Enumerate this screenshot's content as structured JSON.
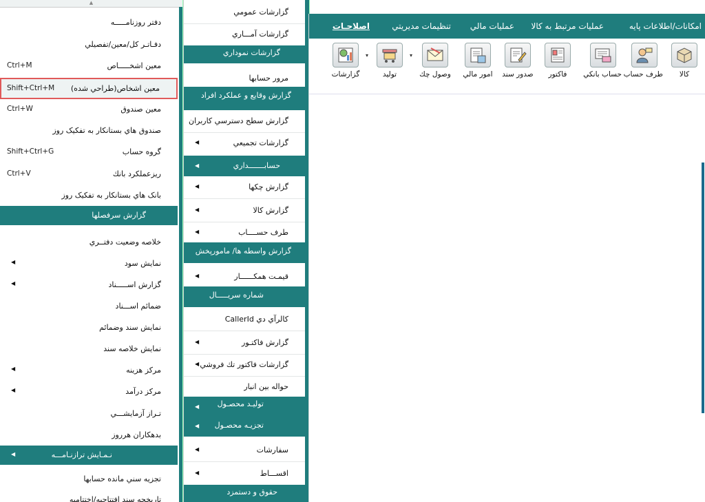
{
  "menubar": {
    "items": [
      "امکانات/اطلاعات پايه",
      "عمليات مرتبط به کالا",
      "عمليات مالي",
      "تنظيمات مديريتي",
      "اصلاحـات"
    ]
  },
  "toolbar": {
    "buttons": [
      "کالا",
      "طرف حساب",
      "حساب بانکي",
      "فاکتور",
      "صدور سند",
      "امور مالي",
      "وصول چك",
      "توليد",
      "گزارشات"
    ]
  },
  "left_menu": {
    "items": [
      {
        "label": "دفتر روزنامـــــه",
        "shortcut": ""
      },
      {
        "label": "دفـاتـر کل/معين/تفصيلي",
        "shortcut": ""
      },
      {
        "label": "معين اشخـــــاص",
        "shortcut": "Ctrl+M"
      },
      {
        "label": "معين اشخاص(طراحي شده)",
        "shortcut": "Shift+Ctrl+M"
      },
      {
        "label": "معين صندوق",
        "shortcut": "Ctrl+W"
      },
      {
        "label": "صندوق هاي بستانکار به تفکيک روز",
        "shortcut": ""
      },
      {
        "label": "گروه حساب",
        "shortcut": "Shift+Ctrl+G"
      },
      {
        "label": "ريزعملکرد بانك",
        "shortcut": "Ctrl+V"
      },
      {
        "label": "بانک هاي بستانکار به تفکيک روز",
        "shortcut": ""
      }
    ],
    "header1": "گزارش سرفصلها",
    "items2": [
      {
        "label": "خلاصه وضعيت دفتــري",
        "submenu": false
      },
      {
        "label": "نمايش سود",
        "submenu": true
      },
      {
        "label": "گزارش   اســـــناد",
        "submenu": true
      },
      {
        "label": "ضمائم اســـناد",
        "submenu": false
      },
      {
        "label": "نمايش سند وضمائم",
        "submenu": false
      },
      {
        "label": "نمايش خلاصه سند",
        "submenu": false
      },
      {
        "label": "مرکز هزينه",
        "submenu": true
      },
      {
        "label": "مرکز درآمد",
        "submenu": true
      },
      {
        "label": "تـراز آزمايشـــي",
        "submenu": false
      },
      {
        "label": "بدهکاران هرروز",
        "submenu": false
      }
    ],
    "header2": "نـمـايش ترازنـامـــه",
    "items3": [
      {
        "label": "تجزيه سني مانده حسابها"
      },
      {
        "label": "تاريخچه سند افتتاحيه/اختتاميه"
      }
    ]
  },
  "mid_menu": {
    "items_a": [
      "گزارشات عمومي",
      "گزارشات آمـــاري"
    ],
    "head_a": "گزارشات نموداري",
    "items_b": [
      "مرور حسابها"
    ],
    "head_b": "گزارش وقايع و عملکرد افراد",
    "items_c": [
      {
        "label": "گزارش سطح دسترسي کاربران",
        "submenu": false
      },
      {
        "label": "گزارشات تجميعي",
        "submenu": true
      }
    ],
    "head_c": "حسابـــــــداري",
    "items_d": [
      {
        "label": "گزارش چکها",
        "submenu": true
      },
      {
        "label": "گزارش کالا",
        "submenu": true
      },
      {
        "label": "طرف حســــاب",
        "submenu": true
      }
    ],
    "head_d": "گزارش واسطه ها/ مامورپخش",
    "items_e": [
      {
        "label": "قيمـت همکــــــار",
        "submenu": true
      }
    ],
    "head_e": "شماره سريـــــال",
    "items_f": [
      {
        "label": "کالرآي دي CallerId",
        "submenu": false
      },
      {
        "label": "گزارش فاکتـور",
        "submenu": true
      },
      {
        "label": "گزارشات فاکتور تك فروشي",
        "submenu": true
      },
      {
        "label": "حواله بين انبار",
        "submenu": false
      }
    ],
    "head_f1": "توليـد محصـول",
    "head_f2": "تجزيـه محصـول",
    "items_g": [
      {
        "label": "سفارشات",
        "submenu": true
      },
      {
        "label": "اقســـاط",
        "submenu": true
      }
    ],
    "head_g": "حقوق و دستمزد"
  }
}
